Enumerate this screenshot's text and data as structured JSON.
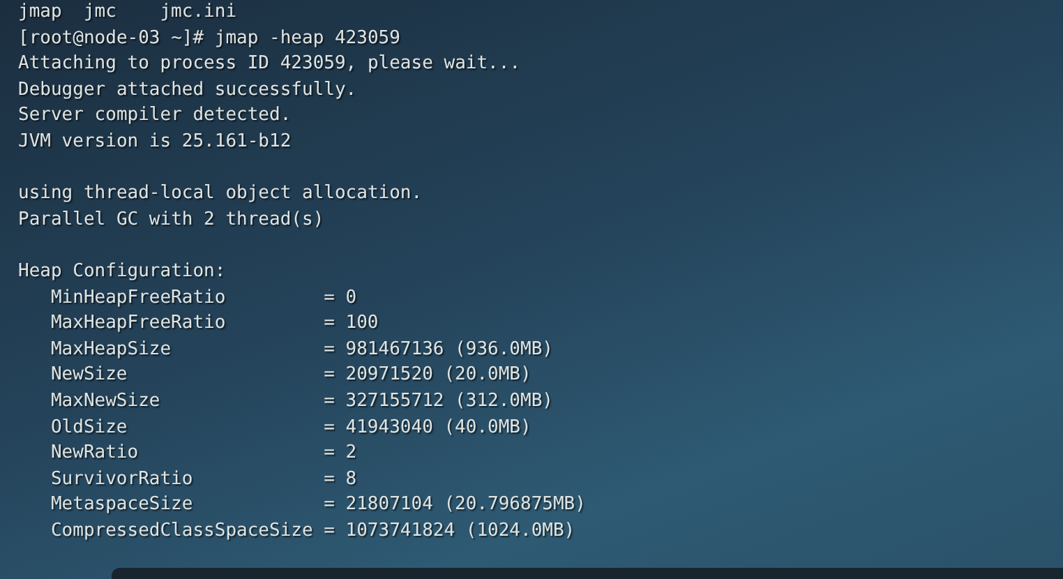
{
  "terminal": {
    "listing": [
      "jmap",
      "jmc",
      "jmc.ini"
    ],
    "command": {
      "prompt": "[root@node-03 ~]#",
      "text": "jmap -heap 423059"
    },
    "attach_output": [
      "Attaching to process ID 423059, please wait...",
      "Debugger attached successfully.",
      "Server compiler detected.",
      "JVM version is 25.161-b12"
    ],
    "gc_output": [
      "using thread-local object allocation.",
      "Parallel GC with 2 thread(s)"
    ],
    "heap_configuration": {
      "heading": "Heap Configuration:",
      "entries": [
        {
          "name": "MinHeapFreeRatio",
          "value": "= 0"
        },
        {
          "name": "MaxHeapFreeRatio",
          "value": "= 100"
        },
        {
          "name": "MaxHeapSize",
          "value": "= 981467136 (936.0MB)"
        },
        {
          "name": "NewSize",
          "value": "= 20971520 (20.0MB)"
        },
        {
          "name": "MaxNewSize",
          "value": "= 327155712 (312.0MB)"
        },
        {
          "name": "OldSize",
          "value": "= 41943040 (40.0MB)"
        },
        {
          "name": "NewRatio",
          "value": "= 2"
        },
        {
          "name": "SurvivorRatio",
          "value": "= 8"
        },
        {
          "name": "MetaspaceSize",
          "value": "= 21807104 (20.796875MB)"
        },
        {
          "name": "CompressedClassSpaceSize",
          "value": "= 1073741824 (1024.0MB)"
        }
      ]
    }
  }
}
